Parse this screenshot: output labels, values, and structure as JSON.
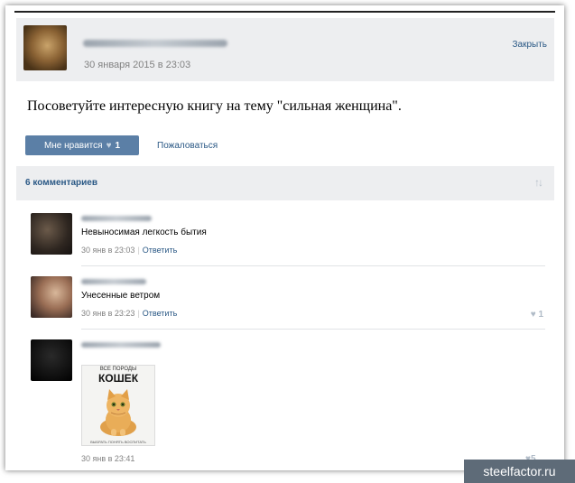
{
  "post": {
    "date": "30 января 2015 в 23:03",
    "close_label": "Закрыть",
    "text": "Посоветуйте интересную книгу на тему \"сильная женщина\".",
    "like_label": "Мне нравится",
    "like_count": "1",
    "report_label": "Пожаловаться"
  },
  "comments_header": {
    "count_label": "6 комментариев",
    "sort_icon": "sort-arrows-icon"
  },
  "comments": [
    {
      "text": "Невыносимая легкость бытия",
      "time": "30 янв в 23:03",
      "reply_label": "Ответить",
      "likes": ""
    },
    {
      "text": "Унесенные ветром",
      "time": "30 янв в 23:23",
      "reply_label": "Ответить",
      "likes": "1"
    },
    {
      "text": "",
      "time": "30 янв в 23:41",
      "reply_label": "",
      "likes": "5"
    }
  ],
  "book": {
    "top_text": "ВСЕ ПОРОДЫ",
    "title": "КОШЕК",
    "bottom_text": "ВЫБРАТЬ  ПОНЯТЬ  ВОСПИТАТЬ"
  },
  "watermark": "steelfactor.ru",
  "colors": {
    "accent": "#2a5885",
    "button": "#5b7fa6",
    "header_bg": "#edeef0"
  }
}
